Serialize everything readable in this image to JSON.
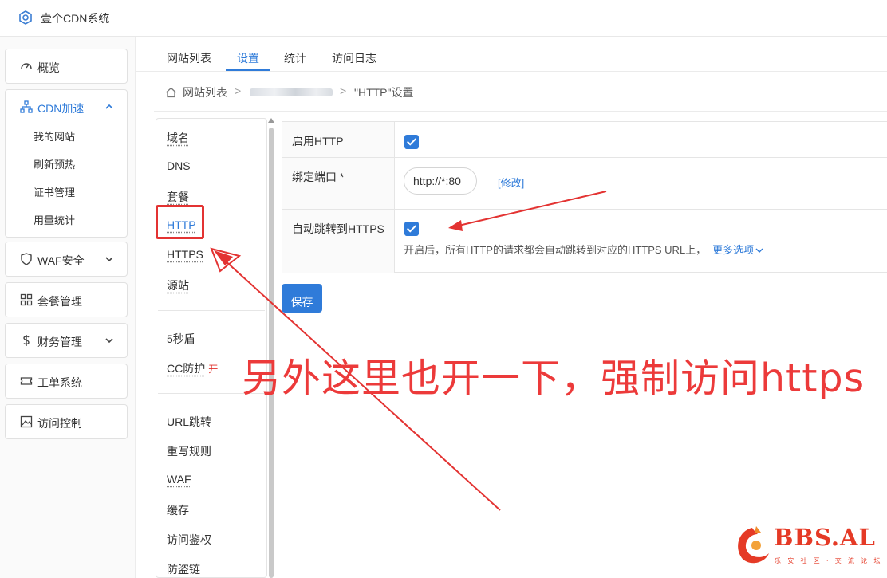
{
  "app": {
    "title": "壹个CDN系统"
  },
  "nav": {
    "overview": "概览",
    "cdn": {
      "label": "CDN加速",
      "items": [
        "我的网站",
        "刷新预热",
        "证书管理",
        "用量统计"
      ]
    },
    "waf": "WAF安全",
    "plans": "套餐管理",
    "finance": "财务管理",
    "tickets": "工单系统",
    "access": "访问控制"
  },
  "tabs": [
    "网站列表",
    "设置",
    "统计",
    "访问日志"
  ],
  "active_tab": "设置",
  "breadcrumb": {
    "root": "网站列表",
    "current": "\"HTTP\"设置"
  },
  "submenu": {
    "group1": [
      "域名",
      "DNS",
      "套餐",
      "HTTP",
      "HTTPS",
      "源站"
    ],
    "group2": [
      "5秒盾",
      "CC防护"
    ],
    "cc_badge": "开",
    "group3": [
      "URL跳转",
      "重写规则",
      "WAF",
      "缓存",
      "访问鉴权",
      "防盗链"
    ],
    "active": "HTTP"
  },
  "settings": {
    "enable_http": {
      "label": "启用HTTP",
      "checked": true
    },
    "bind_port": {
      "label": "绑定端口 *",
      "value": "http://*:80",
      "modify": "[修改]"
    },
    "auto_redirect": {
      "label": "自动跳转到HTTPS",
      "checked": true,
      "help": "开启后，所有HTTP的请求都会自动跳转到对应的HTTPS URL上，",
      "more": "更多选项"
    }
  },
  "save_label": "保存",
  "annotation": {
    "text": "另外这里也开一下，强制访问https",
    "color": "#ec3a3a"
  },
  "watermark": {
    "text": "BBS.AL",
    "sub": "乐 安 社 区 · 交 流 论 坛"
  },
  "colors": {
    "accent": "#2f7bd9",
    "annotation": "#e33332"
  }
}
